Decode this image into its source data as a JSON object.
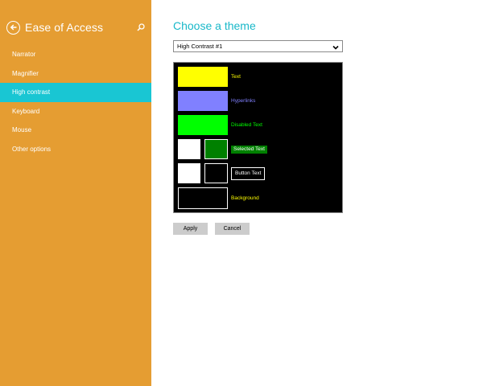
{
  "sidebar": {
    "title": "Ease of Access",
    "back_icon": "arrow-left-circle-icon",
    "search_icon": "search-icon",
    "items": [
      {
        "label": "Narrator",
        "active": false
      },
      {
        "label": "Magnifier",
        "active": false
      },
      {
        "label": "High contrast",
        "active": true
      },
      {
        "label": "Keyboard",
        "active": false
      },
      {
        "label": "Mouse",
        "active": false
      },
      {
        "label": "Other options",
        "active": false
      }
    ]
  },
  "main": {
    "title": "Choose a theme",
    "theme_select": {
      "value": "High Contrast #1"
    },
    "preview": {
      "text_label": "Text",
      "hyperlinks_label": "Hyperlinks",
      "disabled_label": "Disabled Text",
      "selected_label": "Selected Text",
      "button_label": "Button Text",
      "background_label": "Background"
    },
    "apply_label": "Apply",
    "cancel_label": "Cancel"
  },
  "colors": {
    "sidebar_bg": "#e59d32",
    "active_item": "#19c6d3",
    "title_accent": "#19b8c9",
    "text": "#ffff00",
    "hyperlinks": "#8080ff",
    "disabled_text": "#00ff00",
    "selected_bg": "#008000",
    "button_text": "#ffffff",
    "background": "#000000"
  }
}
